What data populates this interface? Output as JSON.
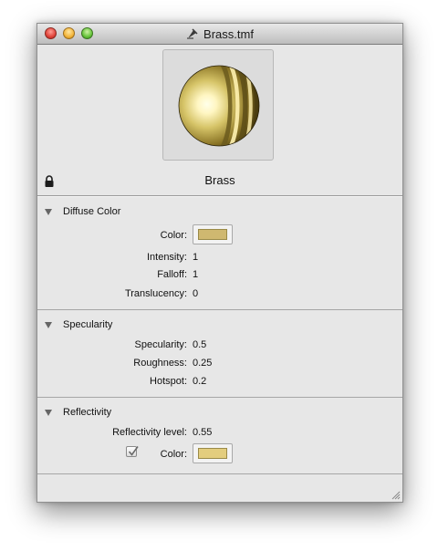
{
  "window": {
    "title": "Brass.tmf",
    "controls": {
      "close": "close-icon",
      "minimize": "minimize-icon",
      "zoom": "zoom-icon"
    }
  },
  "preview": {
    "material_name": "Brass",
    "icons": {
      "lock": "lock-icon",
      "document": "document-icon"
    }
  },
  "diffuse": {
    "header": "Diffuse Color",
    "color_label": "Color:",
    "color_value": "#cfb870",
    "intensity_label": "Intensity:",
    "intensity_value": "1",
    "falloff_label": "Falloff:",
    "falloff_value": "1",
    "translucency_label": "Translucency:",
    "translucency_value": "0"
  },
  "specularity": {
    "header": "Specularity",
    "specularity_label": "Specularity:",
    "specularity_value": "0.5",
    "roughness_label": "Roughness:",
    "roughness_value": "0.25",
    "hotspot_label": "Hotspot:",
    "hotspot_value": "0.2"
  },
  "reflectivity": {
    "header": "Reflectivity",
    "level_label": "Reflectivity level:",
    "level_value": "0.55",
    "color_enabled": true,
    "color_label": "Color:",
    "color_value": "#e3cd7e"
  },
  "colors": {
    "window_bg": "#e7e7e7",
    "separator": "#a6a6a6",
    "brass_highlight": "#fffad6",
    "brass_mid": "#d7c46a",
    "brass_shadow": "#5a4b15"
  }
}
